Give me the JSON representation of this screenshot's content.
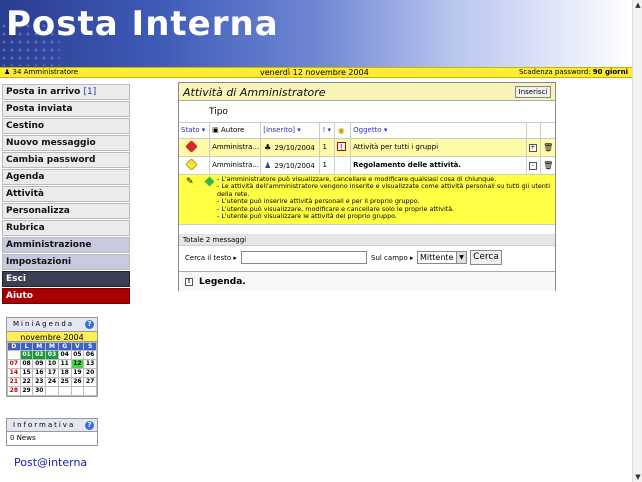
{
  "header": {
    "title": "Posta Interna",
    "user": "34 Amministratore",
    "date": "venerdì 12 novembre 2004",
    "password_label": "Scadenza password:",
    "password_value": "90 giorni"
  },
  "sidebar": {
    "items": [
      {
        "label": "Posta in arrivo",
        "count": "[1]"
      },
      {
        "label": "Posta inviata"
      },
      {
        "label": "Cestino"
      },
      {
        "label": "Nuovo messaggio"
      },
      {
        "label": "Cambia password"
      },
      {
        "label": "Agenda"
      },
      {
        "label": "Attività"
      },
      {
        "label": "Personalizza"
      },
      {
        "label": "Rubrica"
      },
      {
        "label": "Amministrazione"
      },
      {
        "label": "Impostazioni"
      },
      {
        "label": "Esci"
      },
      {
        "label": "Aiuto"
      }
    ]
  },
  "mini_agenda": {
    "title": "MiniAgenda",
    "month": "novembre 2004",
    "weekdays": [
      "D",
      "L",
      "M",
      "M",
      "G",
      "V",
      "S"
    ],
    "weeks": [
      [
        "",
        "01",
        "02",
        "03",
        "04",
        "05",
        "06"
      ],
      [
        "07",
        "08",
        "09",
        "10",
        "11",
        "12",
        "13"
      ],
      [
        "14",
        "15",
        "16",
        "17",
        "18",
        "19",
        "20"
      ],
      [
        "21",
        "22",
        "23",
        "24",
        "25",
        "26",
        "27"
      ],
      [
        "28",
        "29",
        "30",
        "",
        "",
        "",
        ""
      ]
    ],
    "today": "12"
  },
  "informativa": {
    "title": "Informativa",
    "news": "0 News"
  },
  "brand": "Post@interna",
  "main": {
    "title": "Attività di Amministratore",
    "insert_label": "Inserisci",
    "tipo_label": "Tipo",
    "columns": {
      "stato": "Stato",
      "autore": "Autore",
      "inserito": "[Inserito]",
      "priorita": "!",
      "oggetto": "Oggetto"
    },
    "rows": [
      {
        "autore": "Amministra...",
        "data": "29/10/2004",
        "priorita": "1",
        "oggetto": "Attività per tutti i gruppi",
        "stato_color": "#d42a2a",
        "expand": "+"
      },
      {
        "autore": "Amministra...",
        "data": "29/10/2004",
        "priorita": "1",
        "oggetto": "Regolamento delle attività.",
        "stato_color": "#f3e14a",
        "expand": "-"
      }
    ],
    "detail_lines": [
      "- L'amministratore può visualizzare, cancellare e modificare qualsiasi cosa di chiunque.",
      "- Le attività dell'amministratore vengono inserite e visualizzate come attività personali su tutti gli utenti della rete.",
      "- L'utente può inserire attività personali e per il proprio gruppo.",
      "- L'utente può visualizzare, modificare e cancellare solo le proprie attività.",
      "- L'utente può visualizzare le attività del proprio gruppo."
    ],
    "totale": "Totale 2 messaggi",
    "search_label": "Cerca il testo",
    "search_value": "",
    "field_label": "Sul campo",
    "field_value": "Mittente",
    "search_button": "Cerca",
    "legenda": "Legenda."
  }
}
